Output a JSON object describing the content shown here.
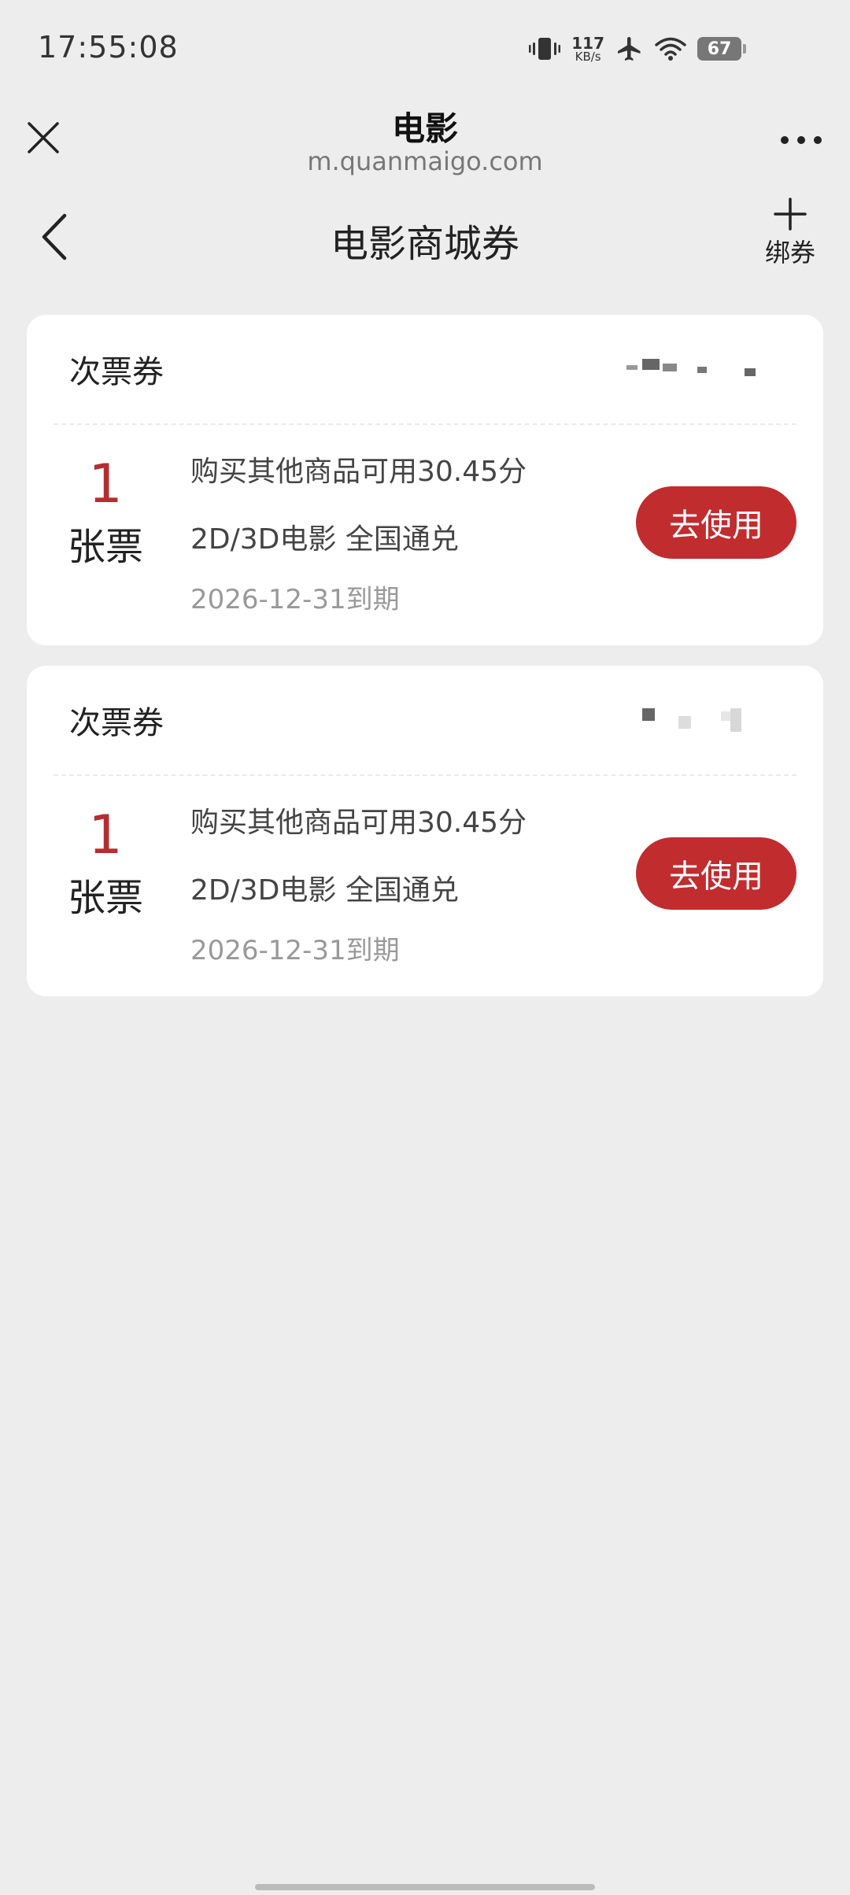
{
  "status_bar": {
    "time": "17:55:08",
    "net_speed_value": "117",
    "net_speed_unit": "KB/s",
    "battery": "67",
    "icons": [
      "vibrate-icon",
      "airplane-icon",
      "wifi-icon",
      "battery-icon"
    ]
  },
  "browser": {
    "title": "电影",
    "url": "m.quanmaigo.com"
  },
  "nav": {
    "title": "电影商城券",
    "bind_label": "绑券"
  },
  "vouchers": [
    {
      "type": "次票券",
      "quantity": "1",
      "unit": "张票",
      "line1": "购买其他商品可用30.45分",
      "line2": "2D/3D电影 全国通兑",
      "expiry": "2026-12-31到期",
      "button": "去使用"
    },
    {
      "type": "次票券",
      "quantity": "1",
      "unit": "张票",
      "line1": "购买其他商品可用30.45分",
      "line2": "2D/3D电影 全国通兑",
      "expiry": "2026-12-31到期",
      "button": "去使用"
    }
  ],
  "colors": {
    "accent": "#c12c2f",
    "quantity": "#b72c30",
    "background": "#ededed"
  }
}
